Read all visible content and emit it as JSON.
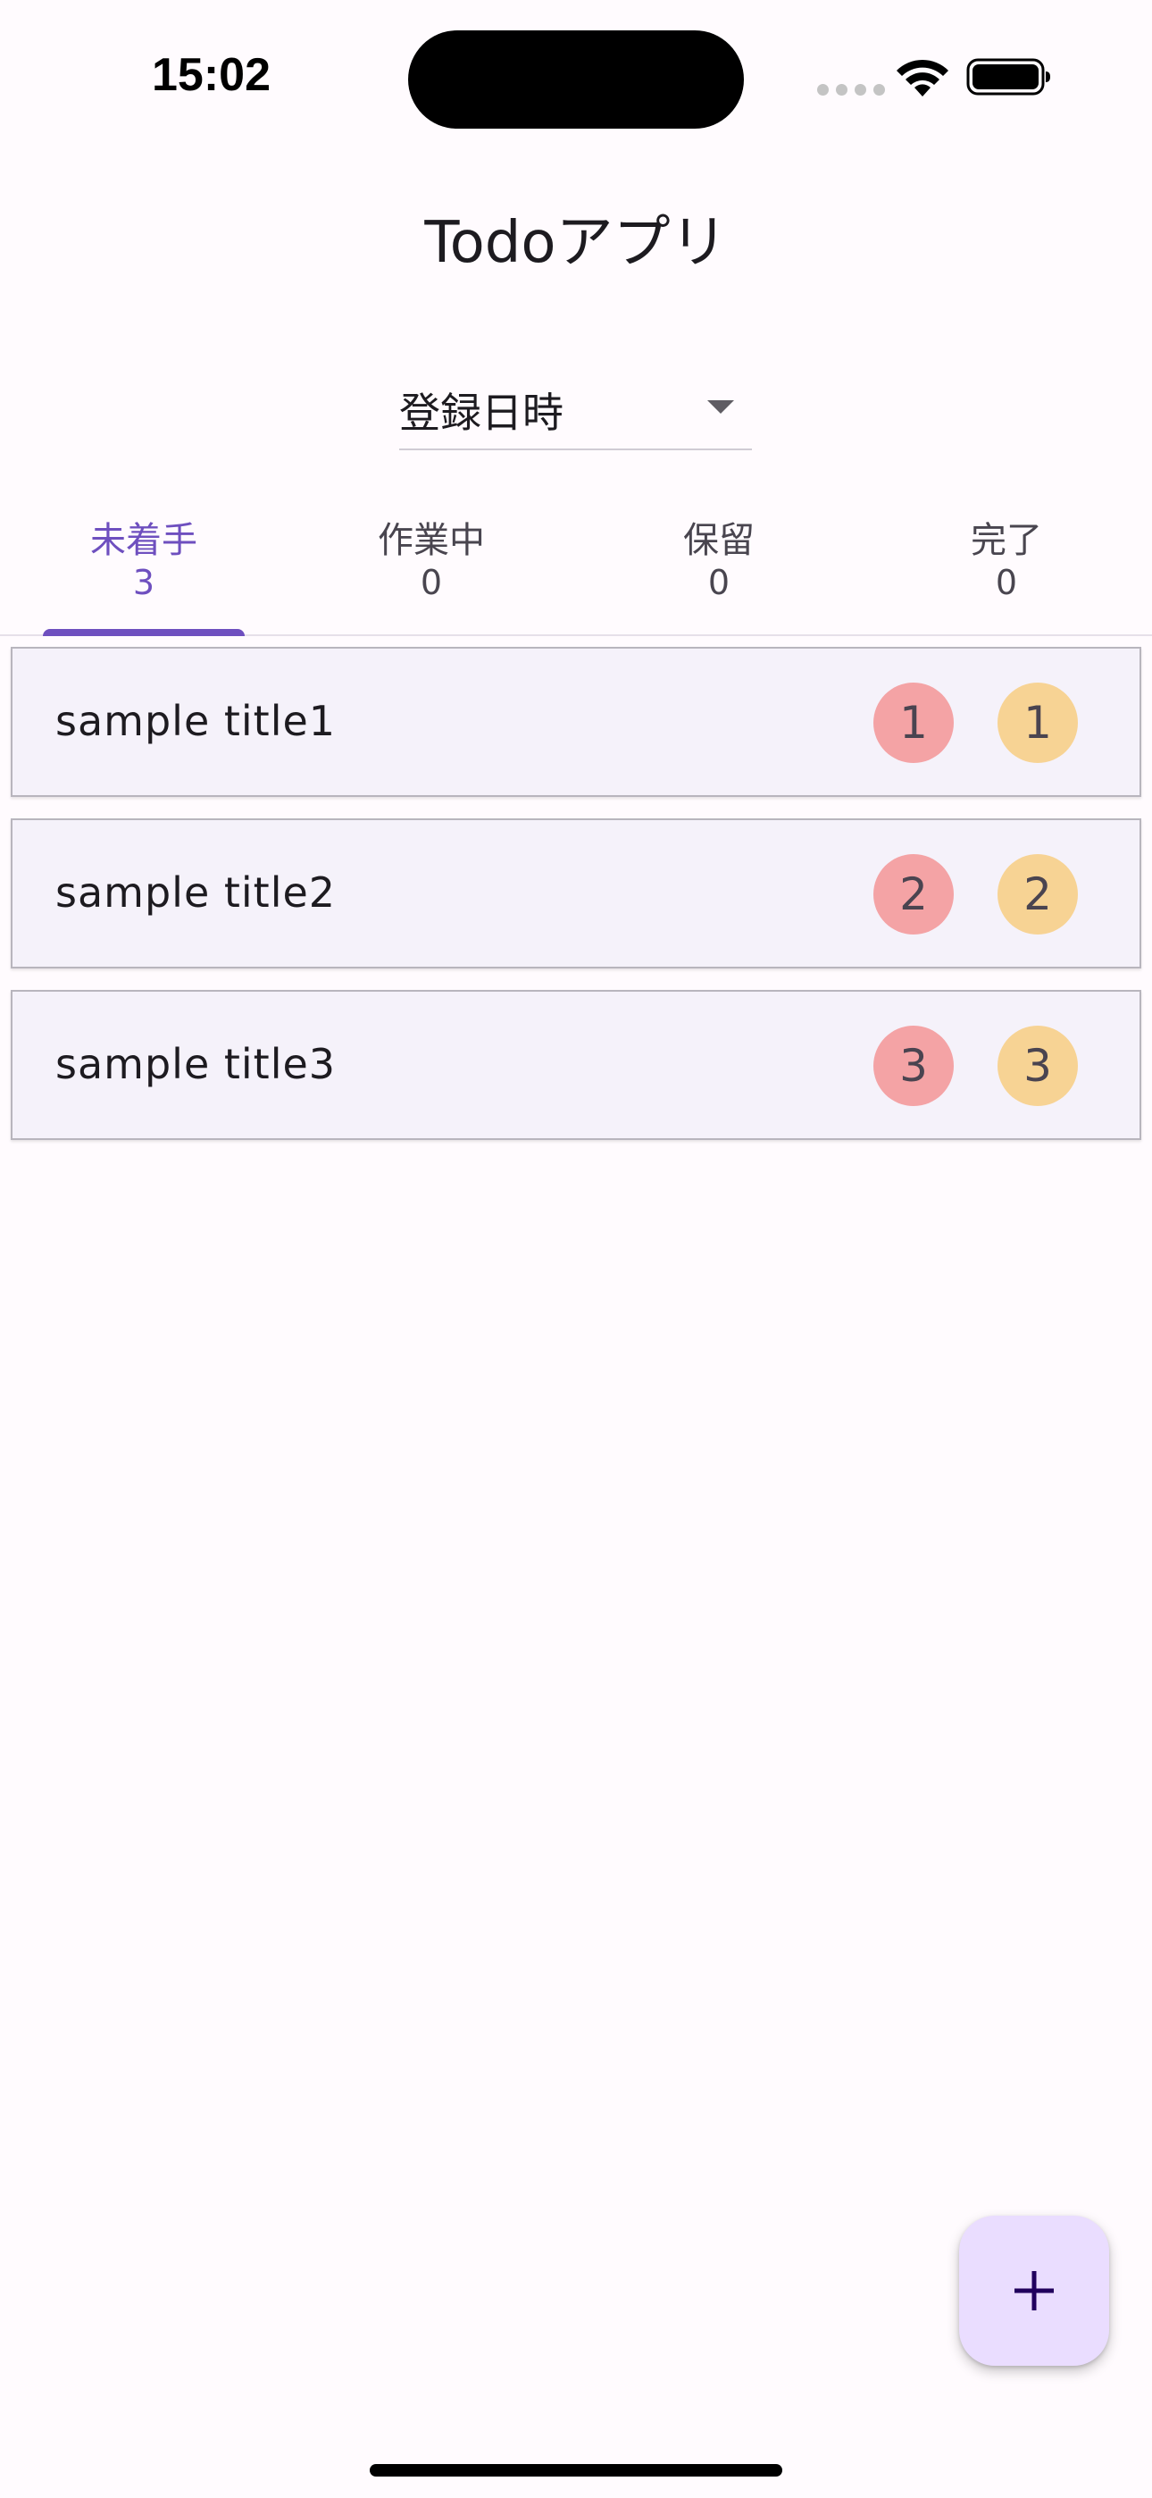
{
  "status_bar": {
    "time": "15:02",
    "icons": [
      "cellular-signal-icon",
      "wifi-icon",
      "battery-icon"
    ]
  },
  "app_bar": {
    "title": "Todoアプリ"
  },
  "sort": {
    "selected": "登録日時",
    "icon": "dropdown-caret-icon"
  },
  "tabs": [
    {
      "label": "未着手",
      "count": "3",
      "active": true
    },
    {
      "label": "作業中",
      "count": "0",
      "active": false
    },
    {
      "label": "保留",
      "count": "0",
      "active": false
    },
    {
      "label": "完了",
      "count": "0",
      "active": false
    }
  ],
  "todos": [
    {
      "title": "sample title1",
      "priority": "1",
      "importance": "1"
    },
    {
      "title": "sample title2",
      "priority": "2",
      "importance": "2"
    },
    {
      "title": "sample title3",
      "priority": "3",
      "importance": "3"
    }
  ],
  "fab": {
    "icon": "add-icon"
  },
  "colors": {
    "accent": "#6e4fbf",
    "priority_badge": "#f4a3a5",
    "importance_badge": "#f7d394",
    "card_background": "#f5f2fa",
    "fab_background": "#eaddff",
    "page_background": "#fffbfe"
  }
}
